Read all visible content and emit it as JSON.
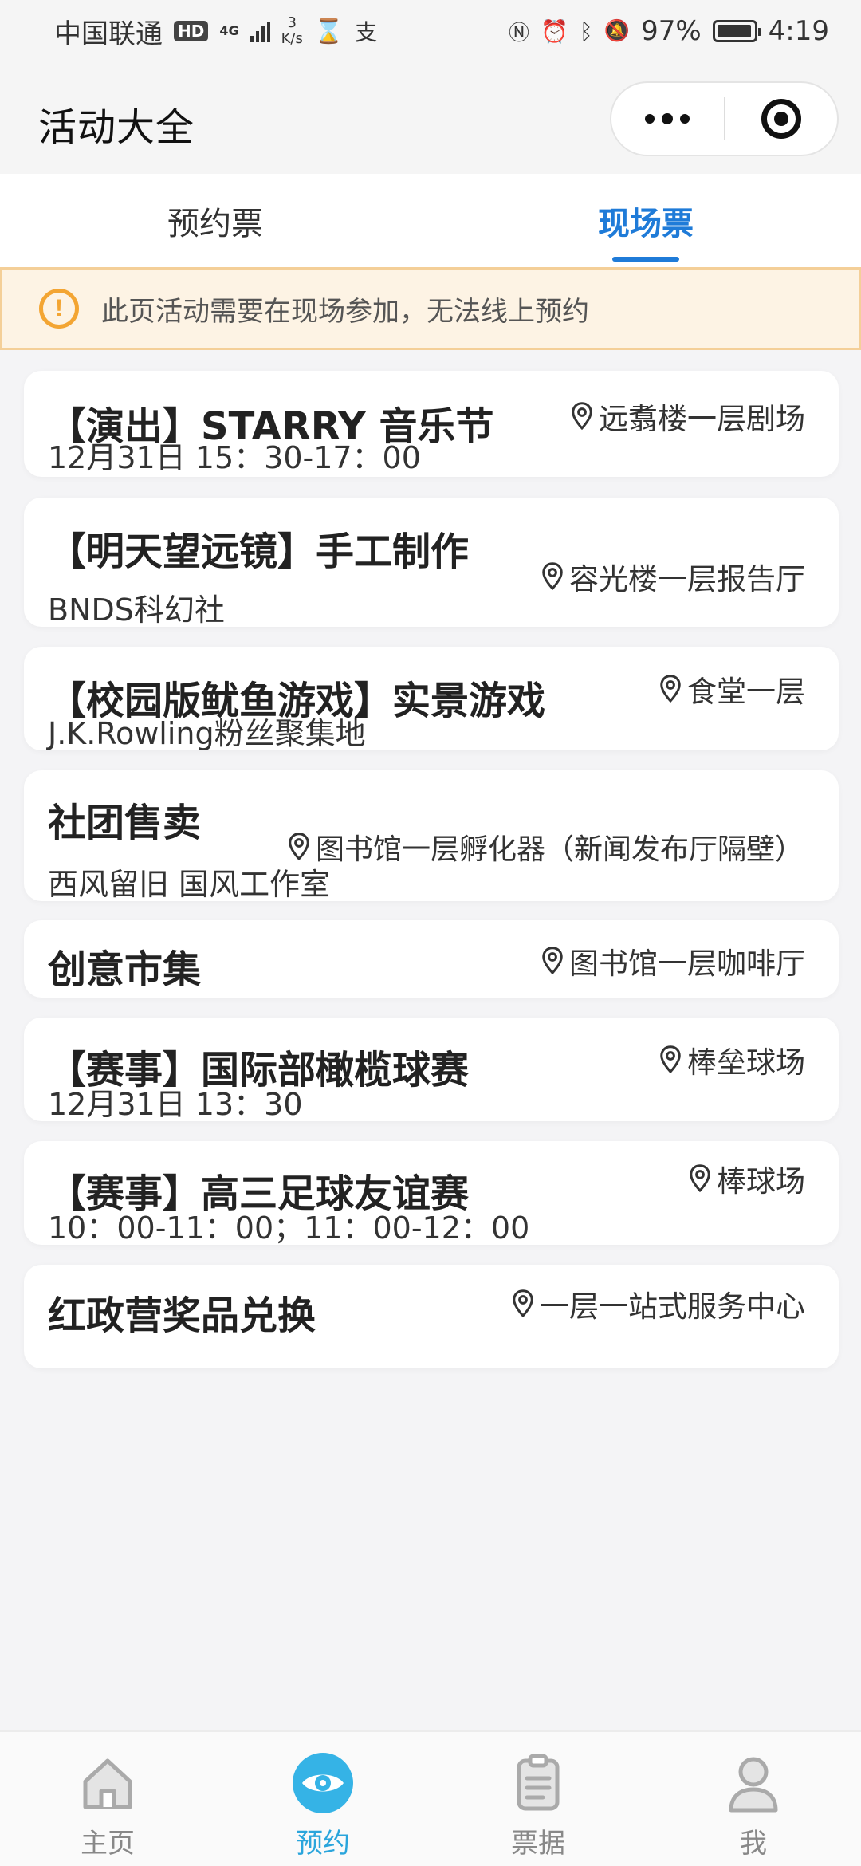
{
  "status_bar": {
    "carrier": "中国联通",
    "hd_badge": "HD",
    "network": "4G",
    "speed_value": "3",
    "speed_unit": "K/s",
    "battery": "97%",
    "battery_level": 0.97,
    "time": "4:19"
  },
  "header": {
    "title": "活动大全"
  },
  "tabs": [
    {
      "label": "预约票",
      "active": false
    },
    {
      "label": "现场票",
      "active": true
    }
  ],
  "notice": {
    "text": "此页活动需要在现场参加，无法线上预约"
  },
  "activities": [
    {
      "title": "【演出】STARRY 音乐节",
      "location": "远翥楼一层剧场",
      "detail": "12月31日 15：30-17：00"
    },
    {
      "title": "【明天望远镜】手工制作",
      "location": "容光楼一层报告厅",
      "detail": "BNDS科幻社"
    },
    {
      "title": "【校园版鱿鱼游戏】实景游戏",
      "location": "食堂一层",
      "detail": "J.K.Rowling粉丝聚集地"
    },
    {
      "title": "社团售卖",
      "location": "图书馆一层孵化器（新闻发布厅隔壁）",
      "detail": "西风留旧 国风工作室"
    },
    {
      "title": "创意市集",
      "location": "图书馆一层咖啡厅",
      "detail": ""
    },
    {
      "title": "【赛事】国际部橄榄球赛",
      "location": "棒垒球场",
      "detail": "12月31日 13：30"
    },
    {
      "title": "【赛事】高三足球友谊赛",
      "location": "棒球场",
      "detail": "10：00-11：00；11：00-12：00"
    },
    {
      "title": "红政营奖品兑换",
      "location": "一层一站式服务中心",
      "detail": ""
    }
  ],
  "tabbar": [
    {
      "label": "主页",
      "icon": "home-icon",
      "active": false
    },
    {
      "label": "预约",
      "icon": "eye-icon",
      "active": true
    },
    {
      "label": "票据",
      "icon": "clipboard-icon",
      "active": false
    },
    {
      "label": "我",
      "icon": "person-icon",
      "active": false
    }
  ],
  "colors": {
    "accent": "#1f7bd8",
    "tabbar_active": "#2aa5dc",
    "notice_bg": "#fdf3e4",
    "notice_icon": "#f3a533"
  }
}
